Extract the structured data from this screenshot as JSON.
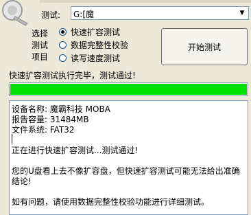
{
  "drive": {
    "label": "测试:",
    "value": "G:[魔"
  },
  "mode": {
    "label_lines": [
      "选择",
      "测试",
      "项目"
    ],
    "options": [
      {
        "label": "快速扩容测试",
        "selected": true
      },
      {
        "label": "数据完整性校验",
        "selected": false
      },
      {
        "label": "读写速度测试",
        "selected": false
      }
    ]
  },
  "start_button": {
    "label": "开始测试"
  },
  "status": {
    "message": "快速扩容测试执行完毕，测试通过!"
  },
  "progress": {
    "fraction": 1.0,
    "color": "#00e000"
  },
  "log": {
    "lines": [
      "设备名称: 魔霸科技 MOBA",
      "报告容量: 31484MB",
      "文件系统: FAT32",
      "",
      "正在进行快速扩容测试...测试通过!",
      "",
      "您的U盘看上去不像扩容盘，但快速扩容测试可能无法给出准确",
      "结论!",
      "",
      "如有问题，请使用数据完整性校验功能进行详细测试。"
    ]
  }
}
